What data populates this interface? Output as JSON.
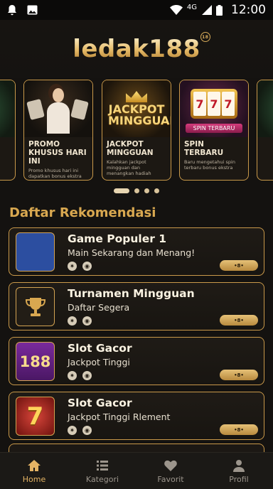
{
  "status_bar": {
    "network": "4G",
    "time": "12:00"
  },
  "header": {
    "logo": "ledak188"
  },
  "banners": [
    {
      "title": "",
      "desc": ""
    },
    {
      "title": "PROMO KHUSUS HARI INI",
      "desc": "Promo khusus hari ini dapatkan bonus ekstra"
    },
    {
      "title": "JACKPOT MINGGUAN",
      "desc": "Kalahkan jackpot mingguan dan menangkan hadiah",
      "art_text": "JACKPOT MINGGUAN"
    },
    {
      "title": "SPIN TERBARU",
      "desc": "Baru mengetahui spin terbaru bonus ekstra",
      "art_text": "SPIN TERBARU"
    },
    {
      "title": "",
      "desc": ""
    }
  ],
  "carousel_dots": {
    "count": 4,
    "active": 0
  },
  "section": {
    "title": "Daftar Rekomendasi"
  },
  "recommendations": [
    {
      "name": "Game Populer 1",
      "subtitle": "Main Sekarang dan Menang!",
      "button": "•8•",
      "thumb": "grid-icons"
    },
    {
      "name": "Turnamen Mingguan",
      "subtitle": "Daftar Segera",
      "button": "•8•",
      "thumb": "trophy-icon"
    },
    {
      "name": "Slot Gacor",
      "subtitle": "Jackpot Tinggi",
      "button": "•8•",
      "thumb": "188",
      "thumb_text": "188"
    },
    {
      "name": "Slot Gacor",
      "subtitle": "Jackpot Tinggi Rlement",
      "button": "•8•",
      "thumb": "seven",
      "thumb_text": "7"
    }
  ],
  "bottom_nav": [
    {
      "label": "Home",
      "icon": "home-icon",
      "active": true
    },
    {
      "label": "Kategori",
      "icon": "list-icon",
      "active": false
    },
    {
      "label": "Favorit",
      "icon": "heart-icon",
      "active": false
    },
    {
      "label": "Profil",
      "icon": "person-icon",
      "active": false
    }
  ],
  "colors": {
    "accent": "#d9a850",
    "background": "#141210",
    "card_border": "#c9994a"
  }
}
